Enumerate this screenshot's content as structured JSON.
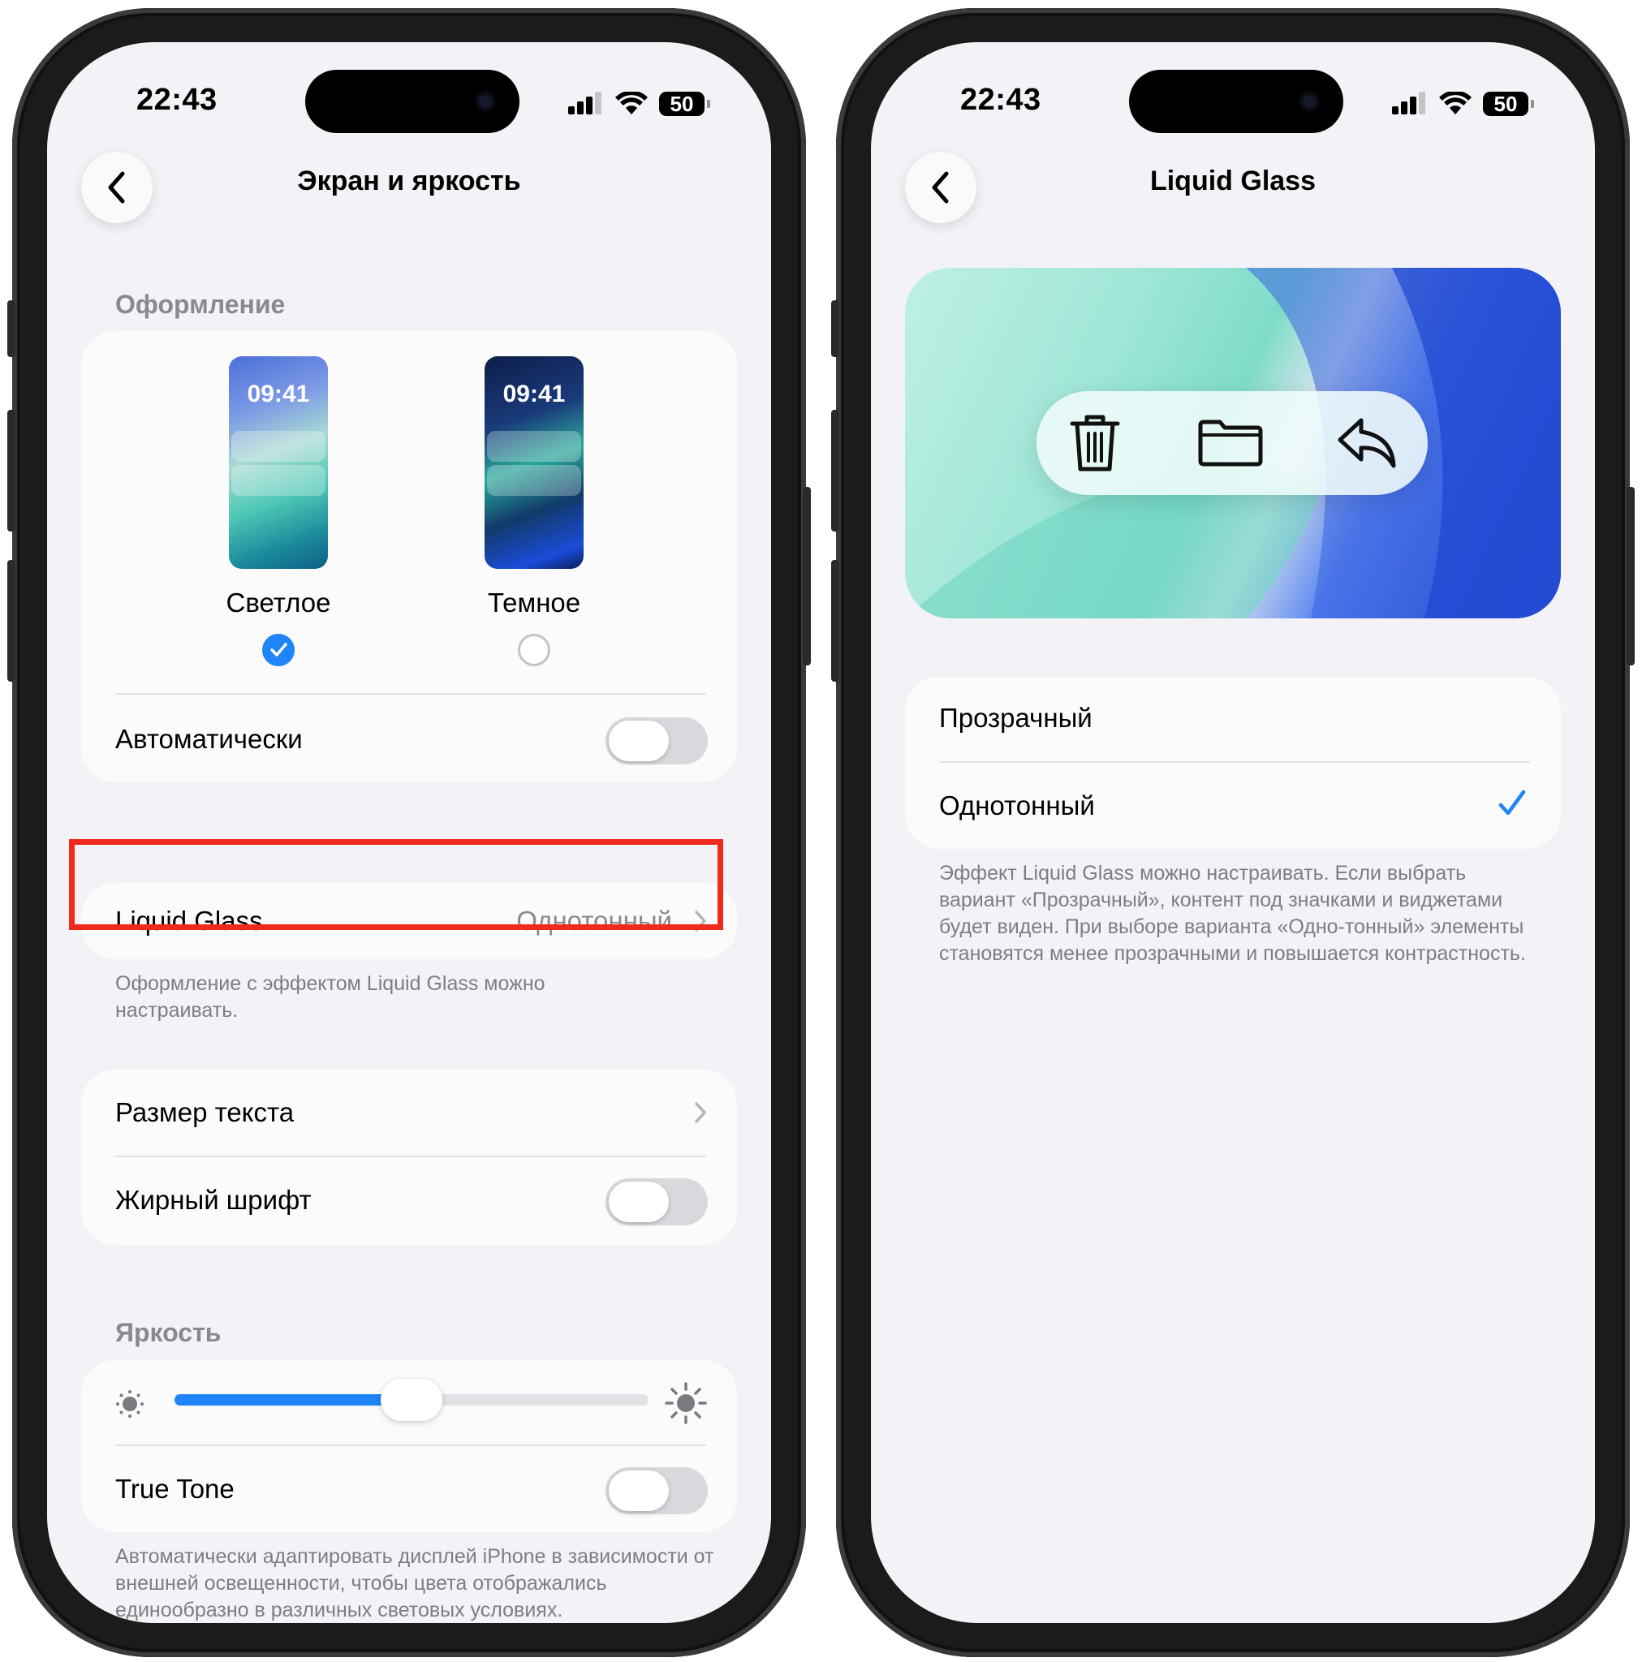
{
  "left": {
    "status": {
      "time": "22:43",
      "battery": "50"
    },
    "nav": {
      "title": "Экран и яркость"
    },
    "appearance": {
      "header": "Оформление",
      "light": {
        "time": "09:41",
        "label": "Светлое",
        "selected": true
      },
      "dark": {
        "time": "09:41",
        "label": "Темное",
        "selected": false
      },
      "auto_label": "Автоматически",
      "auto_on": false
    },
    "liquid_glass": {
      "label": "Liquid Glass",
      "value": "Однотонный",
      "footnote": "Оформление с эффектом Liquid Glass можно настраивать."
    },
    "text": {
      "size_label": "Размер текста",
      "bold_label": "Жирный шрифт",
      "bold_on": false
    },
    "brightness": {
      "header": "Яркость",
      "level": 0.5,
      "true_tone_label": "True Tone",
      "true_tone_on": false,
      "footnote": "Автоматически адаптировать дисплей iPhone в зависимости от внешней освещенности, чтобы цвета отображались единообразно в различных световых условиях."
    }
  },
  "right": {
    "status": {
      "time": "22:43",
      "battery": "50"
    },
    "nav": {
      "title": "Liquid Glass"
    },
    "preview_icons": [
      "trash-icon",
      "folder-icon",
      "reply-icon"
    ],
    "options": [
      {
        "label": "Прозрачный",
        "selected": false
      },
      {
        "label": "Однотонный",
        "selected": true
      }
    ],
    "footnote": "Эффект Liquid Glass можно настраивать. Если выбрать вариант «Прозрачный», контент под значками и виджетами будет виден. При выборе варианта «Одно-тонный» элементы становятся менее прозрачными и повышается контрастность."
  },
  "colors": {
    "accent": "#1f84f5",
    "highlight": "#f02a1a",
    "background": "#f2f2f7"
  }
}
